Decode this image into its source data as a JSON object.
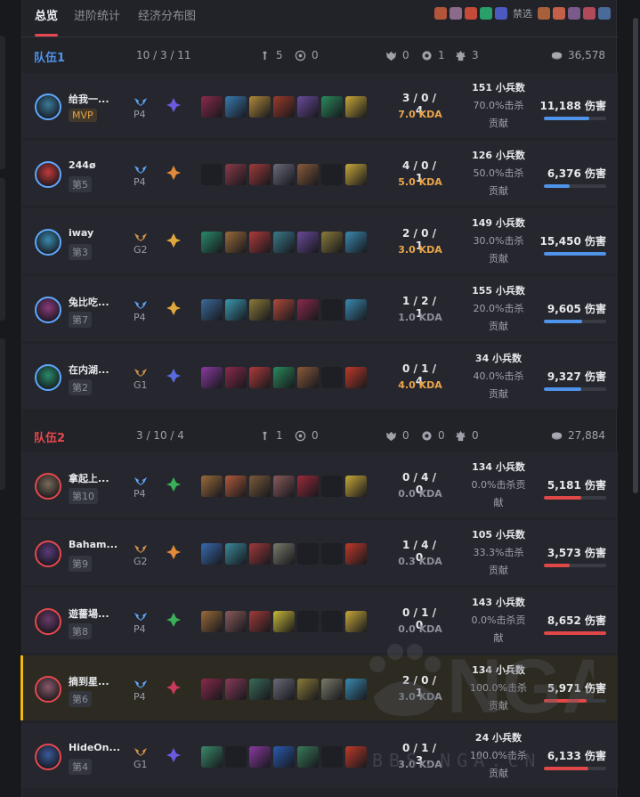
{
  "tabs": [
    {
      "label": "总览",
      "active": true
    },
    {
      "label": "进阶统计",
      "active": false
    },
    {
      "label": "经济分布图",
      "active": false
    }
  ],
  "bans": {
    "label": "禁选",
    "team1_colors": [
      "#b2553a",
      "#8c6a8a",
      "#c44a3a",
      "#28a06a",
      "#4a5ac0"
    ],
    "team2_colors": [
      "#a8603a",
      "#c46048",
      "#7a5a8a",
      "#b04a5a",
      "#4a6a9a"
    ]
  },
  "teams": [
    {
      "name": "队伍1",
      "color": "#4f93ea",
      "kda": "10 / 3 / 11",
      "objectives": {
        "towers": "5",
        "inhibitors": "0",
        "dragons": "0",
        "heralds": "1",
        "barons": "3"
      },
      "gold": "36,578",
      "players": [
        {
          "name": "给我一...",
          "rank": "MVP",
          "is_mvp": true,
          "tier": "P4",
          "tier_color": "#5fa7ff",
          "rune_color": "#6a5ae0",
          "items": [
            "#8a2a4a",
            "#3a7ab0",
            "#b08a3a",
            "#9a3a2a",
            "#6a4a9a",
            "#2a8a5a",
            "#c8a83a"
          ],
          "kda": "3 / 0 / 4",
          "kda_ratio": "7.0 KDA",
          "kda_gold": true,
          "cs": "151 小兵数",
          "kp": "70.0%击杀",
          "kp2": "贡献",
          "damage": "11,188 伤害",
          "damage_frac": 0.73,
          "avatar_color": "#3a7a9a"
        },
        {
          "name": "244ø",
          "rank": "第5",
          "is_mvp": false,
          "tier": "P4",
          "tier_color": "#5fa7ff",
          "rune_color": "#e08a3a",
          "items": [
            "",
            "#8a3a4a",
            "#a03a3a",
            "#6a6a7a",
            "#8a5a3a",
            "",
            "#c8a83a"
          ],
          "kda": "4 / 0 / 1",
          "kda_ratio": "5.0 KDA",
          "kda_gold": true,
          "cs": "126 小兵数",
          "kp": "50.0%击杀",
          "kp2": "贡献",
          "damage": "6,376 伤害",
          "damage_frac": 0.41,
          "avatar_color": "#c03a3a"
        },
        {
          "name": "iway",
          "rank": "第3",
          "is_mvp": false,
          "tier": "G2",
          "tier_color": "#d8954a",
          "rune_color": "#e0a83a",
          "items": [
            "#2a8a6a",
            "#9a6a3a",
            "#b03a3a",
            "#3a7a8a",
            "#6a4a9a",
            "#8a7a3a",
            "#3a8ab0"
          ],
          "kda": "2 / 0 / 1",
          "kda_ratio": "3.0 KDA",
          "kda_gold": true,
          "cs": "149 小兵数",
          "kp": "30.0%击杀",
          "kp2": "贡献",
          "damage": "15,450 伤害",
          "damage_frac": 1.0,
          "avatar_color": "#3a8ab0"
        },
        {
          "name": "兔比吃...",
          "rank": "第7",
          "is_mvp": false,
          "tier": "P4",
          "tier_color": "#5fa7ff",
          "rune_color": "#e0a83a",
          "items": [
            "#3a6a9a",
            "#3a9ab0",
            "#8a7a3a",
            "#b04a3a",
            "#8a2a4a",
            "",
            "#3a8ab0"
          ],
          "kda": "1 / 2 / 1",
          "kda_ratio": "1.0 KDA",
          "kda_gold": false,
          "cs": "155 小兵数",
          "kp": "20.0%击杀",
          "kp2": "贡献",
          "damage": "9,605 伤害",
          "damage_frac": 0.62,
          "avatar_color": "#8a3a7a"
        },
        {
          "name": "在内湖...",
          "rank": "第2",
          "is_mvp": false,
          "tier": "G1",
          "tier_color": "#d8954a",
          "rune_color": "#5a6ae0",
          "items": [
            "#8a3aa0",
            "#8a2a4a",
            "#b03a3a",
            "#2a8a5a",
            "#8a5a3a",
            "",
            "#c03a2a"
          ],
          "kda": "0 / 1 / 4",
          "kda_ratio": "4.0 KDA",
          "kda_gold": true,
          "cs": "34 小兵数",
          "kp": "40.0%击杀",
          "kp2": "贡献",
          "damage": "9,327 伤害",
          "damage_frac": 0.6,
          "avatar_color": "#2a8a6a"
        }
      ]
    },
    {
      "name": "队伍2",
      "color": "#e5484d",
      "kda": "3 / 10 / 4",
      "objectives": {
        "towers": "1",
        "inhibitors": "0",
        "dragons": "0",
        "heralds": "0",
        "barons": "0"
      },
      "gold": "27,884",
      "players": [
        {
          "name": "拿起上...",
          "rank": "第10",
          "is_mvp": false,
          "tier": "P4",
          "tier_color": "#5fa7ff",
          "rune_color": "#3ab05a",
          "items": [
            "#9a6a3a",
            "#b05a3a",
            "#7a5a3a",
            "#8a5a5a",
            "#9a2a3a",
            "",
            "#c8a83a"
          ],
          "kda": "0 / 4 / 0",
          "kda_ratio": "0.0 KDA",
          "kda_gold": false,
          "cs": "134 小兵数",
          "kp": "0.0%击杀贡",
          "kp2": "献",
          "damage": "5,181 伤害",
          "damage_frac": 0.6,
          "avatar_color": "#7a6a5a"
        },
        {
          "name": "Baham...",
          "rank": "第9",
          "is_mvp": false,
          "tier": "G2",
          "tier_color": "#d8954a",
          "rune_color": "#e08a3a",
          "items": [
            "#3a6ab0",
            "#3a8a9a",
            "#a03a3a",
            "#7a7a6a",
            "",
            "",
            "#c03a2a"
          ],
          "kda": "1 / 4 / 0",
          "kda_ratio": "0.3 KDA",
          "kda_gold": false,
          "cs": "105 小兵数",
          "kp": "33.3%击杀",
          "kp2": "贡献",
          "damage": "3,573 伤害",
          "damage_frac": 0.41,
          "avatar_color": "#5a3a7a"
        },
        {
          "name": "遊薔場...",
          "rank": "第8",
          "is_mvp": false,
          "tier": "P4",
          "tier_color": "#5fa7ff",
          "rune_color": "#3ab05a",
          "items": [
            "#9a6a3a",
            "#8a5a5a",
            "#a03a3a",
            "#c8b83a",
            "",
            "",
            "#c8a83a"
          ],
          "kda": "0 / 1 / 0",
          "kda_ratio": "0.0 KDA",
          "kda_gold": false,
          "cs": "143 小兵数",
          "kp": "0.0%击杀贡",
          "kp2": "献",
          "damage": "8,652 伤害",
          "damage_frac": 1.0,
          "avatar_color": "#6a3a6a"
        },
        {
          "name": "摘到星...",
          "rank": "第6",
          "is_mvp": false,
          "highlight": true,
          "tier": "P4",
          "tier_color": "#5fa7ff",
          "rune_color": "#c83a5a",
          "items": [
            "#8a2a4a",
            "#8a3a5a",
            "#3a6a5a",
            "#6a6a7a",
            "#8a7a3a",
            "#7a7a6a",
            "#3a8ab0"
          ],
          "kda": "2 / 0 / 1",
          "kda_ratio": "3.0 KDA",
          "kda_gold": false,
          "cs": "134 小兵数",
          "kp": "100.0%击杀",
          "kp2": "贡献",
          "damage": "5,971 伤害",
          "damage_frac": 0.69,
          "avatar_color": "#8a5a6a"
        },
        {
          "name": "HideOn...",
          "rank": "第4",
          "is_mvp": false,
          "tier": "G1",
          "tier_color": "#d8954a",
          "rune_color": "#6a5ae0",
          "items": [
            "#3a8a6a",
            "",
            "#8a3aa0",
            "#2a5ab0",
            "#3a7a5a",
            "",
            "#c03a2a"
          ],
          "kda": "0 / 1 / 3",
          "kda_ratio": "3.0 KDA",
          "kda_gold": false,
          "cs": "24 小兵数",
          "kp": "100.0%击杀",
          "kp2": "贡献",
          "damage": "6,133 伤害",
          "damage_frac": 0.71,
          "avatar_color": "#3a5a9a"
        }
      ]
    }
  ],
  "watermark": {
    "logo_text": "NGA",
    "site": "BBS.NGA.CN"
  }
}
